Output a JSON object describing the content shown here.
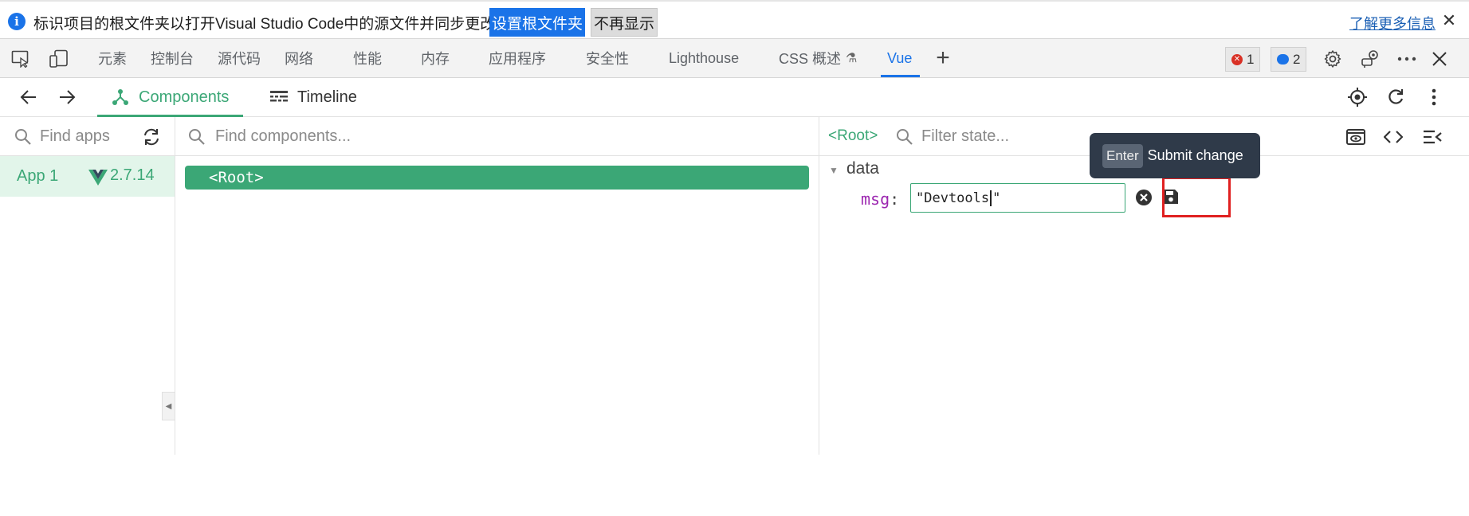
{
  "infobar": {
    "message": "标识项目的根文件夹以打开Visual Studio Code中的源文件并同步更改。",
    "primary_button": "设置根文件夹",
    "secondary_button": "不再显示",
    "learn_more": "了解更多信息"
  },
  "devtools": {
    "tabs": [
      "元素",
      "控制台",
      "源代码",
      "网络",
      "性能",
      "内存",
      "应用程序",
      "安全性",
      "Lighthouse",
      "CSS 概述",
      "Vue"
    ],
    "active_tab": "Vue",
    "error_count": "1",
    "message_count": "2"
  },
  "vue_toolbar": {
    "tabs": [
      {
        "label": "Components",
        "icon": "components-icon",
        "active": true
      },
      {
        "label": "Timeline",
        "icon": "timeline-icon",
        "active": false
      }
    ]
  },
  "apps": {
    "search_placeholder": "Find apps",
    "items": [
      {
        "name": "App 1",
        "version": "2.7.14"
      }
    ]
  },
  "components": {
    "search_placeholder": "Find components...",
    "tree": [
      {
        "label": "<Root>",
        "selected": true
      }
    ]
  },
  "inspector": {
    "breadcrumb": "<Root>",
    "filter_placeholder": "Filter state...",
    "section": "data",
    "fields": [
      {
        "key": "msg",
        "separator": ":",
        "value_before_caret": "\"Devtools",
        "value_after_caret": "\""
      }
    ]
  },
  "tooltip": {
    "key": "Enter",
    "text": "Submit change"
  },
  "colors": {
    "vue_green": "#3ba776",
    "accent_blue": "#1a73e8",
    "highlight_red": "#e02020",
    "tooltip_bg": "#2f3a49"
  }
}
